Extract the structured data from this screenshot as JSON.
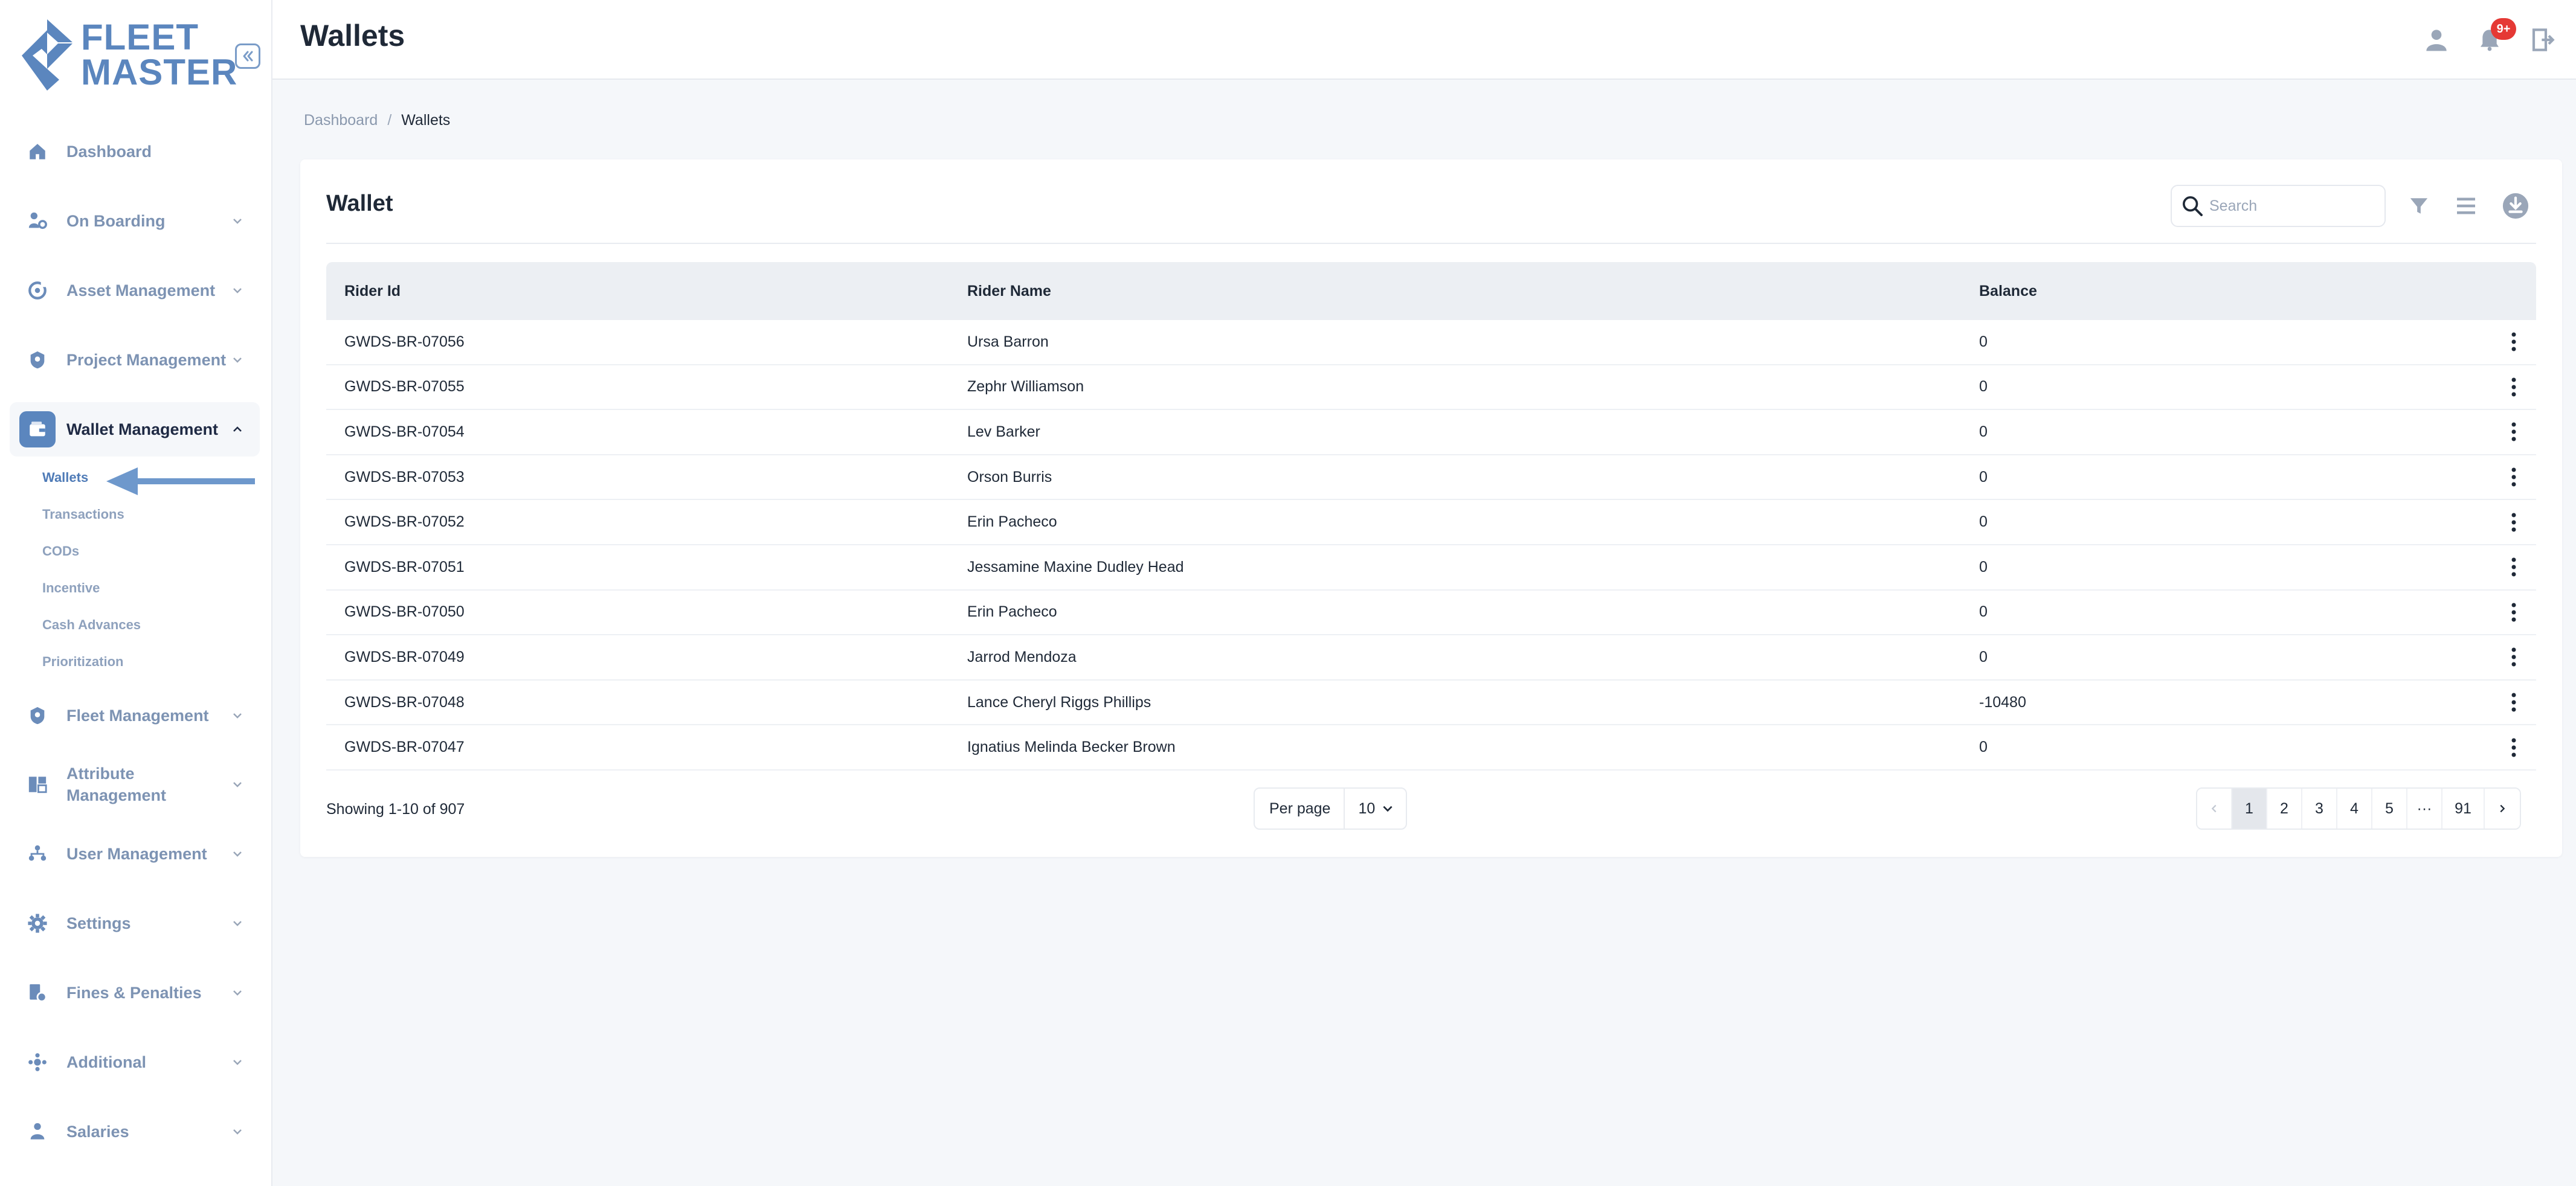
{
  "brand": {
    "line1": "FLEET",
    "line2": "MASTER",
    "color": "#5b86be"
  },
  "header": {
    "title": "Wallets",
    "notification_count": "9+"
  },
  "sidebar": {
    "items": [
      {
        "label": "Dashboard",
        "icon": "home-icon"
      },
      {
        "label": "On Boarding",
        "icon": "onboarding-icon"
      },
      {
        "label": "Asset Management",
        "icon": "asset-icon"
      },
      {
        "label": "Project Management",
        "icon": "project-icon"
      },
      {
        "label": "Wallet Management",
        "icon": "wallet-icon",
        "active": true
      },
      {
        "label": "Fleet Management",
        "icon": "fleet-icon"
      },
      {
        "label": "Attribute Management",
        "icon": "attribute-icon"
      },
      {
        "label": "User Management",
        "icon": "users-icon"
      },
      {
        "label": "Settings",
        "icon": "gear-icon"
      },
      {
        "label": "Fines & Penalties",
        "icon": "fines-icon"
      },
      {
        "label": "Additional",
        "icon": "additional-icon"
      },
      {
        "label": "Salaries",
        "icon": "salaries-icon"
      }
    ],
    "wallet_subitems": [
      "Wallets",
      "Transactions",
      "CODs",
      "Incentive",
      "Cash Advances",
      "Prioritization"
    ]
  },
  "breadcrumb": {
    "root": "Dashboard",
    "separator": "/",
    "current": "Wallets"
  },
  "card": {
    "title": "Wallet",
    "search_placeholder": "Search"
  },
  "table": {
    "columns": [
      "Rider Id",
      "Rider Name",
      "Balance"
    ],
    "rows": [
      [
        "GWDS-BR-07056",
        "Ursa Barron",
        "0"
      ],
      [
        "GWDS-BR-07055",
        "Zephr Williamson",
        "0"
      ],
      [
        "GWDS-BR-07054",
        "Lev Barker",
        "0"
      ],
      [
        "GWDS-BR-07053",
        "Orson Burris",
        "0"
      ],
      [
        "GWDS-BR-07052",
        "Erin Pacheco",
        "0"
      ],
      [
        "GWDS-BR-07051",
        "Jessamine Maxine Dudley Head",
        "0"
      ],
      [
        "GWDS-BR-07050",
        "Erin Pacheco",
        "0"
      ],
      [
        "GWDS-BR-07049",
        "Jarrod Mendoza",
        "0"
      ],
      [
        "GWDS-BR-07048",
        "Lance Cheryl Riggs Phillips",
        "-10480"
      ],
      [
        "GWDS-BR-07047",
        "Ignatius Melinda Becker Brown",
        "0"
      ]
    ]
  },
  "footer": {
    "showing": "Showing 1-10 of 907",
    "per_page_label": "Per page",
    "per_page_value": "10",
    "pages": [
      "1",
      "2",
      "3",
      "4",
      "5",
      "···",
      "91"
    ],
    "current_page": "1"
  }
}
